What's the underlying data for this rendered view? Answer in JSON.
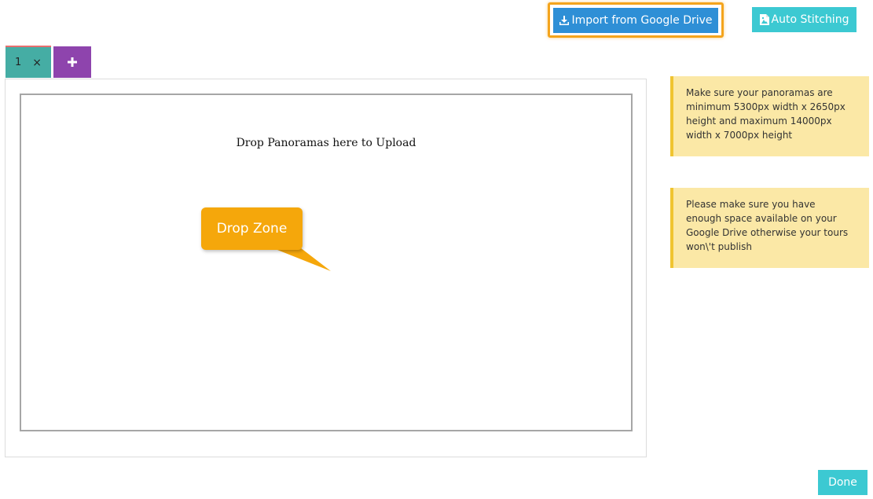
{
  "toolbar": {
    "import_label": "Import from Google Drive",
    "import_icon": "download-icon",
    "auto_label": "Auto Stitching",
    "auto_icon": "file-image-icon"
  },
  "tabs": [
    {
      "label": "1",
      "close": "×"
    }
  ],
  "add_tab": {
    "icon": "plus-icon"
  },
  "dropzone": {
    "text": "Drop Panoramas here to Upload"
  },
  "callout": {
    "text": "Drop Zone"
  },
  "notes": [
    {
      "text": "Make sure your panoramas are minimum 5300px width x 2650px height and maximum 14000px width x 7000px height"
    },
    {
      "text": "Please make sure you have enough space available on your Google Drive otherwise your tours won\\'t publish"
    }
  ],
  "footer": {
    "done_label": "Done"
  },
  "colors": {
    "import_button": "#2e8fd6",
    "highlight_border": "#f4a41c",
    "teal_button": "#3cc9d2",
    "tab": "#45ada4",
    "add_tab": "#8e44ad",
    "callout": "#f5a70b",
    "note_bg": "#fbe8a6",
    "note_border": "#f0c430"
  }
}
